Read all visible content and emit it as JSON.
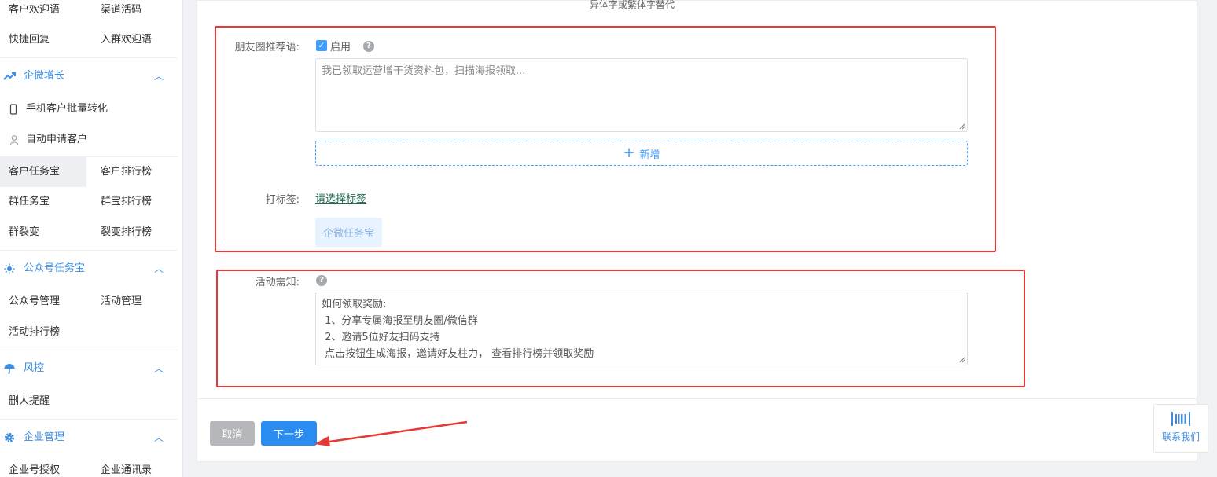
{
  "sidebar": {
    "top_rows": [
      {
        "c1": "客户欢迎语",
        "c2": "渠道活码"
      },
      {
        "c1": "快捷回复",
        "c2": "入群欢迎语"
      }
    ],
    "groups": {
      "growth": {
        "title": "企微增长",
        "subs": [
          "手机客户批量转化",
          "自动申请客户"
        ],
        "rows": [
          {
            "c1": "客户任务宝",
            "c2": "客户排行榜"
          },
          {
            "c1": "群任务宝",
            "c2": "群宝排行榜"
          },
          {
            "c1": "群裂变",
            "c2": "裂变排行榜"
          }
        ]
      },
      "official": {
        "title": "公众号任务宝",
        "rows": [
          {
            "c1": "公众号管理",
            "c2": "活动管理"
          },
          {
            "c1": "活动排行榜",
            "c2": ""
          }
        ]
      },
      "risk": {
        "title": "风控",
        "rows": [
          {
            "c1": "删人提醒",
            "c2": ""
          }
        ]
      },
      "enterprise": {
        "title": "企业管理",
        "rows": [
          {
            "c1": "企业号授权",
            "c2": "企业通讯录"
          }
        ]
      }
    }
  },
  "form": {
    "top_hint": "异体字或繁体字替代",
    "moments": {
      "label": "朋友圈推荐语:",
      "enable_label": "启用",
      "enabled": true,
      "text": "我已领取运营增干货资料包，扫描海报领取...",
      "add_label": "新增"
    },
    "tag": {
      "label": "打标签:",
      "link": "请选择标签",
      "chip": "企微任务宝"
    },
    "notice": {
      "label": "活动需知:",
      "lines": [
        "如何领取奖励:",
        " 1、分享专属海报至朋友圈/微信群",
        " 2、邀请5位好友扫码支持",
        " 点击按钮生成海报，邀请好友柱力， 查看排行榜并领取奖励"
      ]
    }
  },
  "footer": {
    "cancel_label": "取消",
    "next_label": "下一步"
  },
  "contact": {
    "label": "联系我们"
  },
  "colors": {
    "accent": "#409eff",
    "annotation": "#e53935"
  }
}
